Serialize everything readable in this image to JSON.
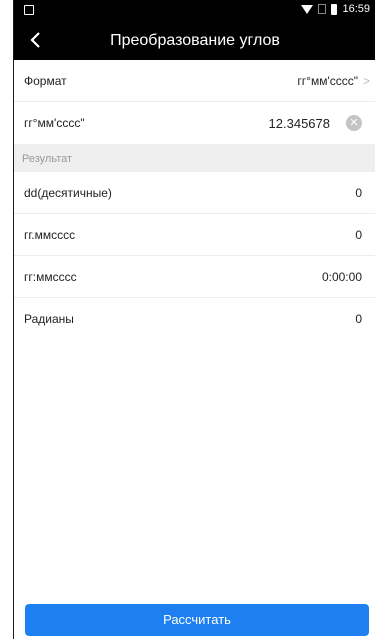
{
  "status_bar": {
    "time": "16:59"
  },
  "app_bar": {
    "title": "Преобразование углов"
  },
  "format": {
    "label": "Формат",
    "value": "гг°мм'сссс\""
  },
  "input": {
    "label": "гг°мм'сссс\"",
    "value": "12.345678"
  },
  "result_section": {
    "title": "Результат"
  },
  "results": [
    {
      "label": "dd(десятичные)",
      "value": "0"
    },
    {
      "label": "гг.ммсссс",
      "value": "0"
    },
    {
      "label": "гг:ммсссс",
      "value": "0:00:00"
    },
    {
      "label": "Радианы",
      "value": "0"
    }
  ],
  "calculate_button": {
    "label": "Рассчитать"
  },
  "colors": {
    "accent": "#1e80f0",
    "appbar": "#000000",
    "section_bg": "#efefef"
  }
}
